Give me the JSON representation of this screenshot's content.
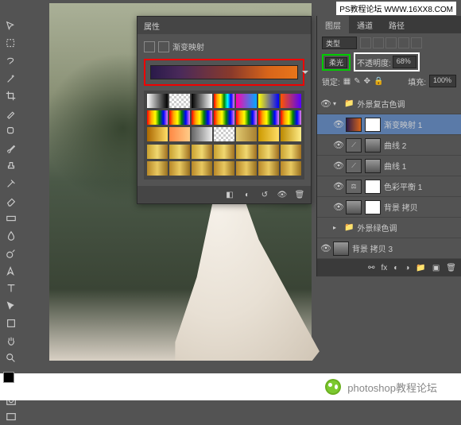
{
  "watermark": "PS教程论坛  WWW.16XX8.COM",
  "properties_panel": {
    "title": "属性",
    "adjustment_label": "渐变映射",
    "gradient_stops": [
      "#2a1a4a",
      "#4a2a5a",
      "#8a3a2a",
      "#d8651a",
      "#e8751a"
    ]
  },
  "layers_panel": {
    "tabs": [
      "图层",
      "通道",
      "路径"
    ],
    "kind_label": "类型",
    "blend_mode": "柔光",
    "opacity_label": "不透明度:",
    "opacity_value": "68%",
    "lock_label": "锁定:",
    "fill_label": "填充:",
    "fill_value": "100%",
    "groups": [
      {
        "name": "外景复古色调",
        "expanded": true
      },
      {
        "name": "外景绿色调",
        "expanded": false
      }
    ],
    "layers": [
      {
        "name": "渐变映射 1",
        "type": "gradient-map",
        "selected": true
      },
      {
        "name": "曲线 2",
        "type": "curves"
      },
      {
        "name": "曲线 1",
        "type": "curves"
      },
      {
        "name": "色彩平衡 1",
        "type": "color-balance"
      },
      {
        "name": "背景 拷贝",
        "type": "image"
      },
      {
        "name": "背景 拷贝 3",
        "type": "image"
      }
    ]
  },
  "footer": {
    "text": "photoshop教程论坛"
  }
}
